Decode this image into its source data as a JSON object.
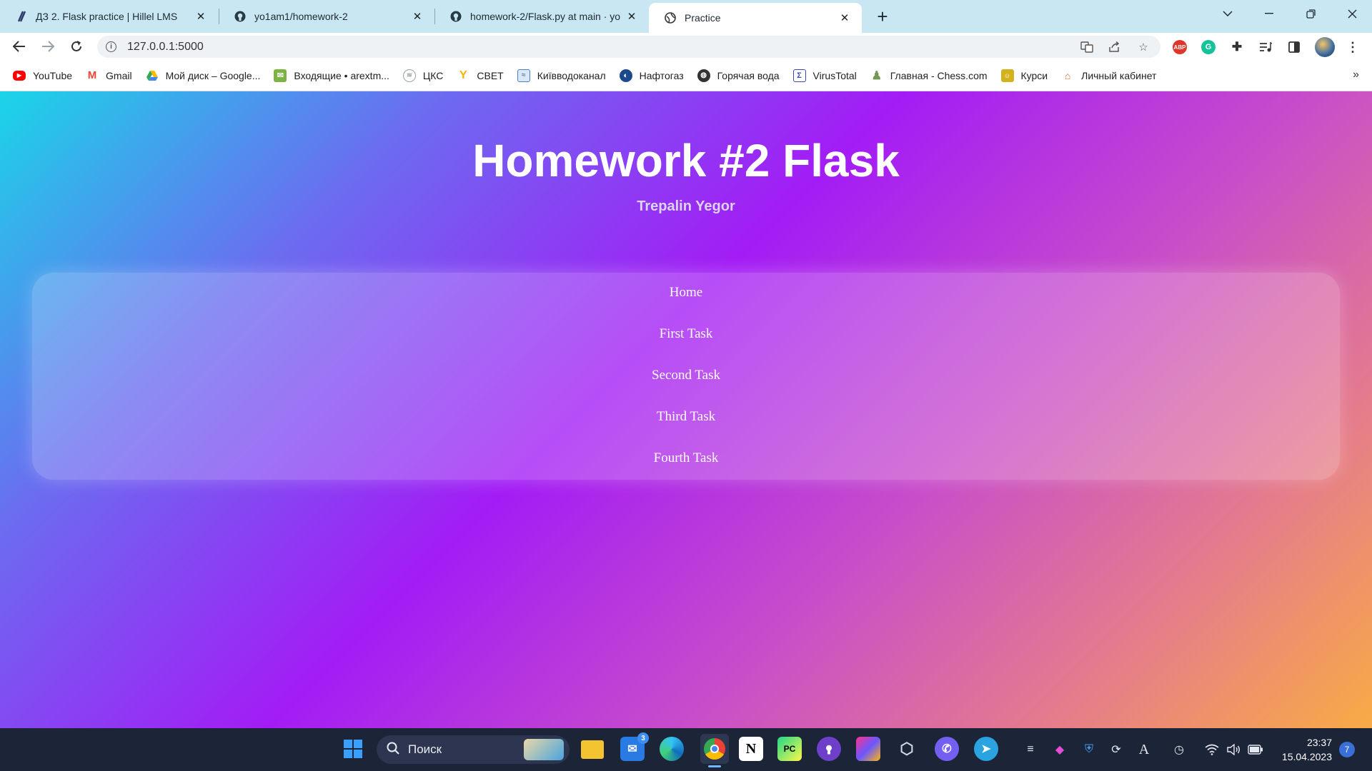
{
  "browser": {
    "tabs": [
      {
        "title": "ДЗ 2. Flask practice | Hillel LMS",
        "icon": "hillel-icon",
        "active": false
      },
      {
        "title": "yo1am1/homework-2",
        "icon": "github-icon",
        "active": false
      },
      {
        "title": "homework-2/Flask.py at main · yo",
        "icon": "github-icon",
        "active": false
      },
      {
        "title": "Practice",
        "icon": "globe-icon",
        "active": true
      }
    ],
    "new_tab": "+",
    "url": "127.0.0.1:5000",
    "bookmarks": [
      {
        "label": "YouTube",
        "icon": "youtube-icon",
        "color": "#ff0000"
      },
      {
        "label": "Gmail",
        "icon": "gmail-icon",
        "color": "#ea4335"
      },
      {
        "label": "Мой диск – Google...",
        "icon": "drive-icon",
        "color": "#34a853"
      },
      {
        "label": "Входящие • arextm...",
        "icon": "mail-icon",
        "color": "#7cb342"
      },
      {
        "label": "ЦКС",
        "icon": "cks-icon",
        "color": "#9aa0a6"
      },
      {
        "label": "СВЕТ",
        "icon": "svet-icon",
        "color": "#f4b400"
      },
      {
        "label": "Київводоканал",
        "icon": "water-icon",
        "color": "#4a7fc1"
      },
      {
        "label": "Нафтогаз",
        "icon": "naftogaz-icon",
        "color": "#1a4a8c"
      },
      {
        "label": "Горячая вода",
        "icon": "globe-icon",
        "color": "#333333"
      },
      {
        "label": "VirusTotal",
        "icon": "virustotal-icon",
        "color": "#3949ab"
      },
      {
        "label": "Главная - Chess.com",
        "icon": "chess-icon",
        "color": "#769656"
      },
      {
        "label": "Курси",
        "icon": "courses-icon",
        "color": "#d4b21b"
      },
      {
        "label": "Личный кабинет",
        "icon": "cabinet-icon",
        "color": "#e06d2c"
      }
    ],
    "extensions": {
      "abp": "ABP"
    }
  },
  "page": {
    "title": "Homework #2 Flask",
    "author": "Trepalin Yegor",
    "nav": [
      "Home",
      "First Task",
      "Second Task",
      "Third Task",
      "Fourth Task"
    ]
  },
  "taskbar": {
    "search_label": "Поиск",
    "mail_badge": "3",
    "time": "23:37",
    "date": "15.04.2023",
    "notifications": "7"
  },
  "colors": {
    "gradient": [
      "#1ad5e8",
      "#a31cf5",
      "#f9ab45"
    ],
    "tabstrip": "#c8e7f3",
    "taskbar": "#1c2437"
  }
}
